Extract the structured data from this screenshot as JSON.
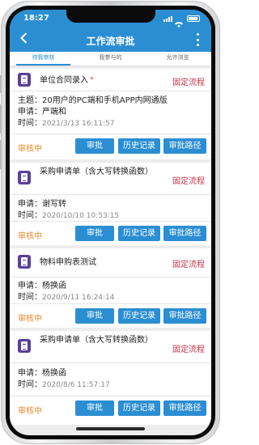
{
  "status_bar": {
    "time": "18:27"
  },
  "nav": {
    "title": "工作流审批"
  },
  "tabs": [
    {
      "label": "待我审核",
      "active": true
    },
    {
      "label": "我参与的",
      "active": false
    },
    {
      "label": "允许浏览",
      "active": false
    }
  ],
  "cards": [
    {
      "title": "单位合同录入",
      "required": "*",
      "tag": "固定流程",
      "subject_key": "主题：",
      "subject": "20用户的PC端和手机APP内网通版",
      "applicant_key": "申请：",
      "applicant": "严端和",
      "time_key": "时间：",
      "time": "2021/3/13 16:11:57",
      "status": "审核中"
    },
    {
      "title": "采购申请单（含大写转换函数）",
      "tag": "固定流程",
      "applicant_key": "申请：",
      "applicant": "谢写转",
      "time_key": "时间：",
      "time": "2020/10/10 10:53:15",
      "status": "审核中"
    },
    {
      "title": "物料申购表测试",
      "tag": "固定流程",
      "applicant_key": "申请：",
      "applicant": "杨换函",
      "time_key": "时间：",
      "time": "2020/9/11 16:24:14",
      "status": "审核中"
    },
    {
      "title": "采购申请单（含大写转换函数）",
      "tag": "固定流程",
      "applicant_key": "申请：",
      "applicant": "杨换函",
      "time_key": "时间：",
      "time": "2020/8/6 11:57:17",
      "status": "审核中"
    }
  ],
  "buttons": {
    "approve": "审批",
    "history": "历史记录",
    "path": "审批路径"
  },
  "colors": {
    "primary": "#2b8ed3",
    "tag": "#c8344a",
    "status": "#e58a2d",
    "doc_icon": "#5b3f98"
  },
  "icons": {
    "back": "chevron-left-icon",
    "more": "more-vertical-icon",
    "doc": "document-icon"
  }
}
